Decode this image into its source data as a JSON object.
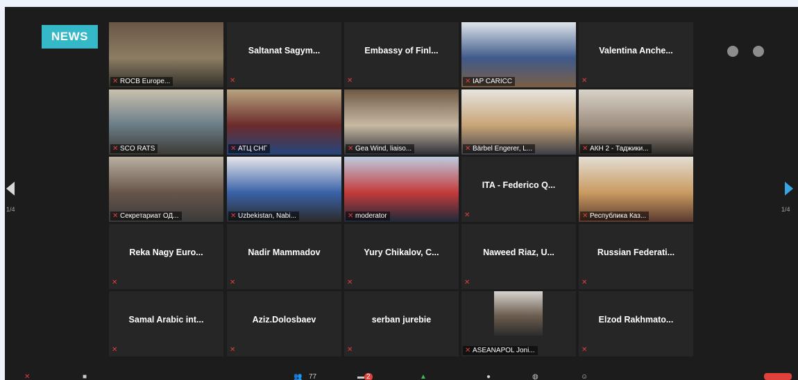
{
  "badge": "NEWS",
  "pager": {
    "left": "1/4",
    "right": "1/4"
  },
  "participants": [
    {
      "name": "ROCB Europe...",
      "video": true
    },
    {
      "name": "Saltanat Sagym...",
      "video": false
    },
    {
      "name": "Embassy of Finl...",
      "video": false
    },
    {
      "name": "IAP CARICC",
      "video": true
    },
    {
      "name": "Valentina Anche...",
      "video": false
    },
    {
      "name": "SCO RATS",
      "video": true
    },
    {
      "name": "АТЦ СНГ",
      "video": true
    },
    {
      "name": "Gea Wind, liaiso...",
      "video": true
    },
    {
      "name": "Bärbel Engerer, L...",
      "video": true
    },
    {
      "name": "АКН 2 - Таджики...",
      "video": true
    },
    {
      "name": "Секретариат ОД...",
      "video": true
    },
    {
      "name": "Uzbekistan, Nabi...",
      "video": true
    },
    {
      "name": "moderator",
      "video": true,
      "active": true
    },
    {
      "name": "ITA - Federico Q...",
      "video": false
    },
    {
      "name": "Республика Каз...",
      "video": true
    },
    {
      "name": "Reka Nagy Euro...",
      "video": false
    },
    {
      "name": "Nadir Mammadov",
      "video": false
    },
    {
      "name": "Yury Chikalov, C...",
      "video": false
    },
    {
      "name": "Naweed Riaz, U...",
      "video": false
    },
    {
      "name": "Russian Federati...",
      "video": false
    },
    {
      "name": "Samal Arabic int...",
      "video": false
    },
    {
      "name": "Aziz.Dolosbaev",
      "video": false
    },
    {
      "name": "serban jurebie",
      "video": false
    },
    {
      "name": "ASEANAPOL Joni...",
      "video": true
    },
    {
      "name": "Elzod Rakhmato...",
      "video": false
    }
  ],
  "toolbar": {
    "participants_count": "77",
    "chat_badge": "2"
  },
  "colors": {
    "active_border": "#c6de55",
    "badge_bg": "#35b9c9",
    "muted_mic": "#e0413b",
    "next_arrow": "#36a6e0"
  }
}
